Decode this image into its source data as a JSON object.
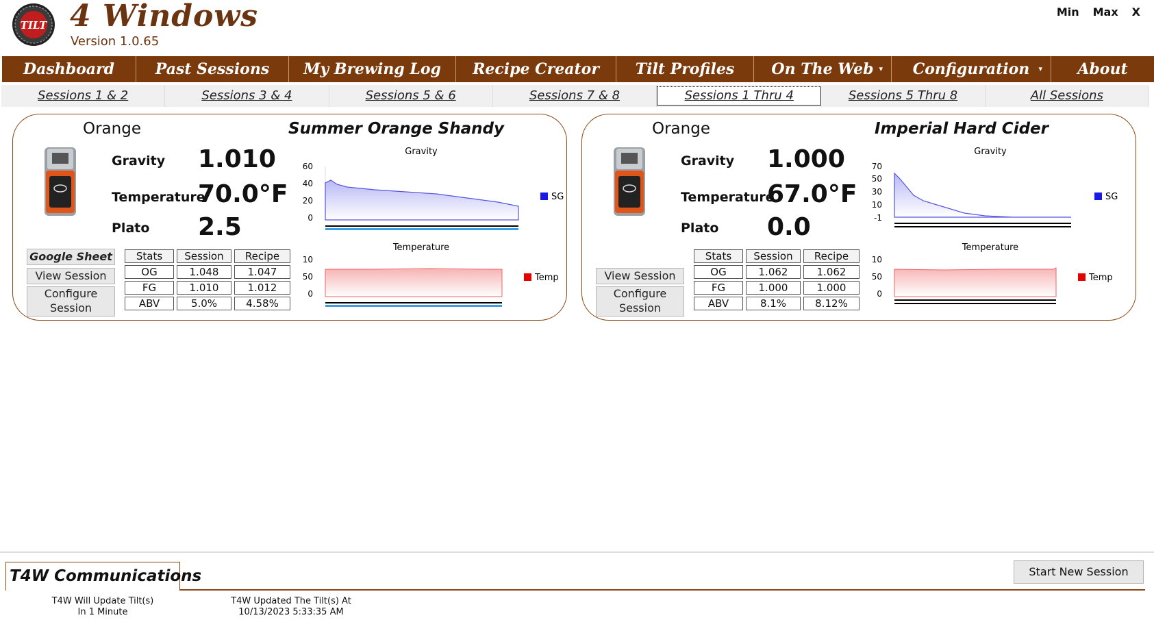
{
  "app": {
    "title": "4 Windows",
    "version": "Version 1.0.65",
    "logo_text": "TILT",
    "window_controls": [
      "Min",
      "Max",
      "X"
    ]
  },
  "main_nav": [
    {
      "label": "Dashboard",
      "has_dropdown": false
    },
    {
      "label": "Past Sessions",
      "has_dropdown": false
    },
    {
      "label": "My Brewing Log",
      "has_dropdown": false
    },
    {
      "label": "Recipe Creator",
      "has_dropdown": false
    },
    {
      "label": "Tilt Profiles",
      "has_dropdown": false
    },
    {
      "label": "On The Web",
      "has_dropdown": true
    },
    {
      "label": "Configuration",
      "has_dropdown": true
    },
    {
      "label": "About",
      "has_dropdown": false
    }
  ],
  "sub_tabs": [
    "Sessions 1 & 2",
    "Sessions 3 & 4",
    "Sessions 5 & 6",
    "Sessions 7 & 8",
    "Sessions 1 Thru 4",
    "Sessions 5 Thru 8",
    "All Sessions"
  ],
  "active_sub_tab": "Sessions 1 Thru 4",
  "sessions": [
    {
      "tilt_color": "Orange",
      "beer_name": "Summer Orange Shandy",
      "gravity_label": "Gravity",
      "gravity": "1.010",
      "temperature_label": "Temperature",
      "temperature": "70.0°F",
      "plato_label": "Plato",
      "plato": "2.5",
      "buttons": {
        "google_sheet": "Google Sheet",
        "view_session": "View Session",
        "configure_session": "Configure Session"
      },
      "stats_table": {
        "headers": [
          "Stats",
          "Session",
          "Recipe"
        ],
        "rows": [
          [
            "OG",
            "1.048",
            "1.047"
          ],
          [
            "FG",
            "1.010",
            "1.012"
          ],
          [
            "ABV",
            "5.0%",
            "4.58%"
          ]
        ]
      },
      "gravity_chart": {
        "title": "Gravity",
        "y_ticks": [
          "60",
          "40",
          "20",
          "0"
        ],
        "legend": "SG",
        "color": "#1a1ae6"
      },
      "temp_chart": {
        "title": "Temperature",
        "y_ticks": [
          "10",
          "50",
          "0"
        ],
        "legend": "Temp",
        "color": "#e60000"
      }
    },
    {
      "tilt_color": "Orange",
      "beer_name": "Imperial Hard Cider",
      "gravity_label": "Gravity",
      "gravity": "1.000",
      "temperature_label": "Temperature",
      "temperature": "67.0°F",
      "plato_label": "Plato",
      "plato": "0.0",
      "buttons": {
        "view_session": "View Session",
        "configure_session": "Configure Session"
      },
      "stats_table": {
        "headers": [
          "Stats",
          "Session",
          "Recipe"
        ],
        "rows": [
          [
            "OG",
            "1.062",
            "1.062"
          ],
          [
            "FG",
            "1.000",
            "1.000"
          ],
          [
            "ABV",
            "8.1%",
            "8.12%"
          ]
        ]
      },
      "gravity_chart": {
        "title": "Gravity",
        "y_ticks": [
          "70",
          "50",
          "30",
          "10",
          "-1"
        ],
        "legend": "SG",
        "color": "#1a1ae6"
      },
      "temp_chart": {
        "title": "Temperature",
        "y_ticks": [
          "10",
          "50",
          "0"
        ],
        "legend": "Temp",
        "color": "#e60000"
      }
    }
  ],
  "footer": {
    "comm_title": "T4W Communications",
    "start_button": "Start New Session",
    "update_next_line1": "T4W Will Update Tilt(s)",
    "update_next_line2": "In 1 Minute",
    "update_last_line1": "T4W Updated The Tilt(s) At",
    "update_last_line2": "10/13/2023 5:33:35 AM"
  },
  "colors": {
    "brand_brown": "#7a3a0c",
    "panel_border": "#8b4513",
    "sg_series": "#1a1ae6",
    "temp_series": "#e60000"
  }
}
